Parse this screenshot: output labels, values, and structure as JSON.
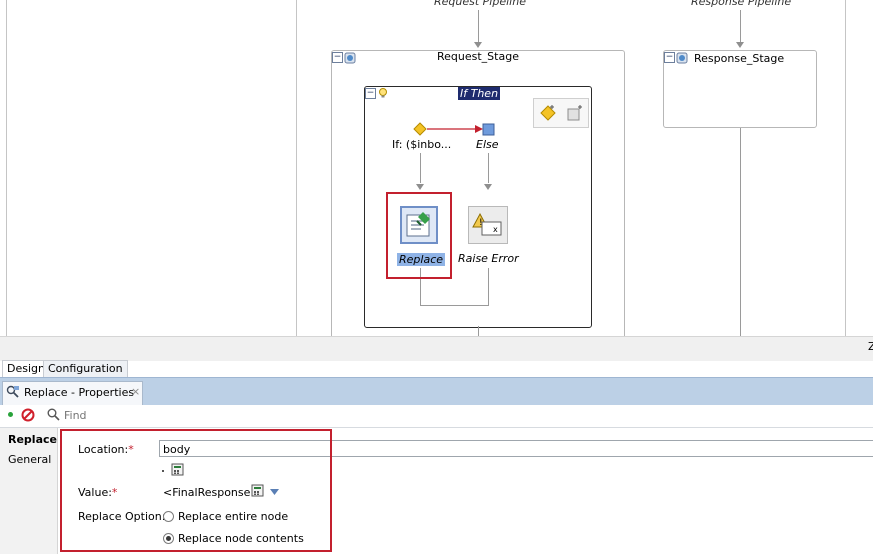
{
  "canvas": {
    "request_pipeline_label": "Request Pipeline",
    "response_pipeline_label": "Response Pipeline",
    "request_stage_label": "Request_Stage",
    "response_stage_label": "Response_Stage",
    "if_then_label": "If Then",
    "if_branch_label": "If: ($inbo...",
    "else_branch_label": "Else",
    "replace_action_label": "Replace",
    "raise_error_label": "Raise Error",
    "corner_glyph": "Z"
  },
  "editor_tabs": [
    {
      "label": "Design"
    },
    {
      "label": "Configuration"
    }
  ],
  "properties_panel": {
    "title": "Replace - Properties",
    "close_glyph": "×",
    "search_placeholder": "Find",
    "side_tabs": [
      {
        "label": "Replace"
      },
      {
        "label": "General"
      }
    ],
    "location_label": "Location:",
    "location_value": "body",
    "value_label": "Value:",
    "value_text": "<FinalResponse>",
    "required_marker": "*",
    "replace_option_label": "Replace Option:",
    "option_entire": "Replace entire node",
    "option_contents": "Replace node contents",
    "selected_option": "contents"
  },
  "colors": {
    "highlight_red": "#c3202e",
    "panel_header_blue": "#bcd0e6",
    "selection_blue": "#3f6fd6",
    "if_then_header": "#1e2b6e"
  }
}
